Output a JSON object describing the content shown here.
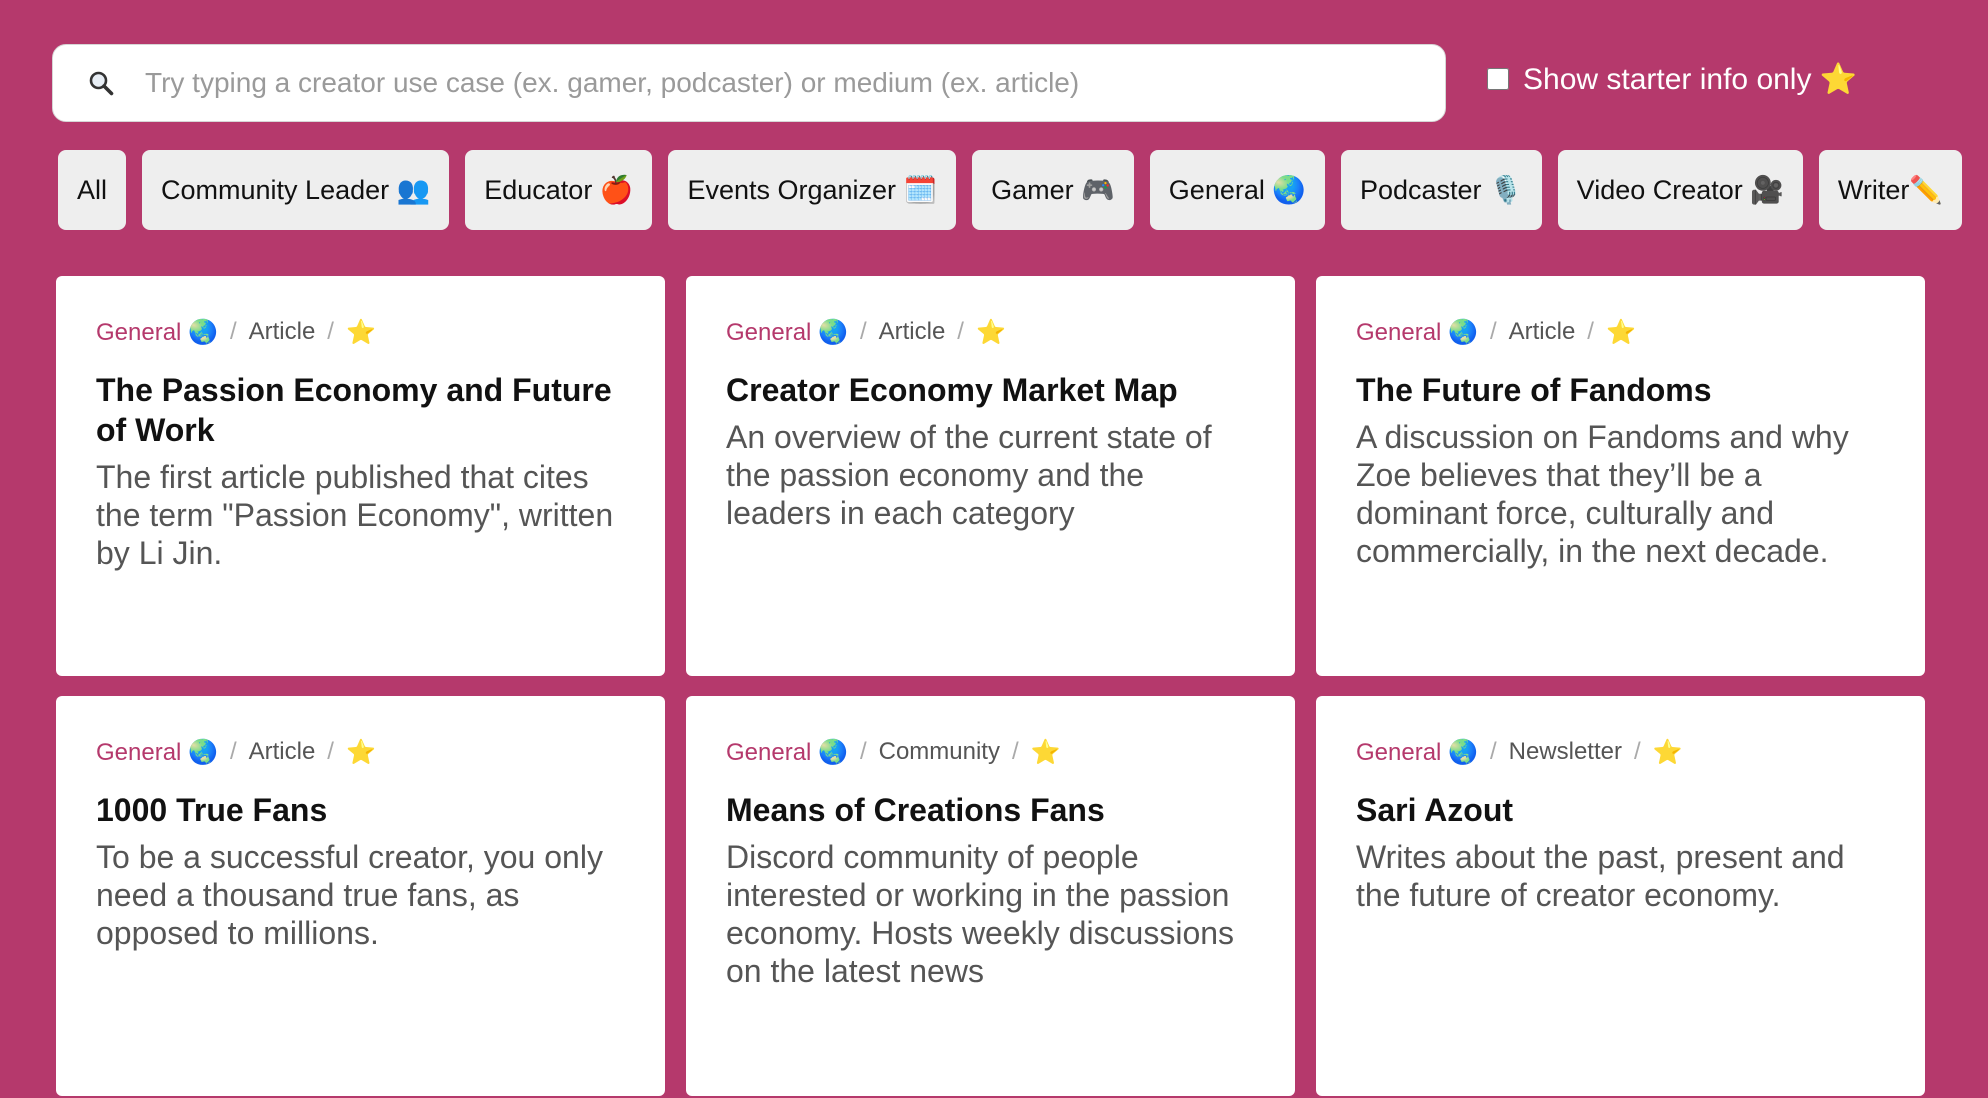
{
  "search": {
    "icon": "search-icon",
    "placeholder": "Try typing a creator use case (ex. gamer, podcaster) or medium (ex. article)"
  },
  "starter_toggle": {
    "label": "Show starter info only ⭐",
    "checked": false
  },
  "filters": [
    {
      "label": "All"
    },
    {
      "label": "Community Leader 👥"
    },
    {
      "label": "Educator 🍎"
    },
    {
      "label": "Events Organizer 🗓️"
    },
    {
      "label": "Gamer 🎮"
    },
    {
      "label": "General 🌏"
    },
    {
      "label": "Podcaster 🎙️"
    },
    {
      "label": "Video Creator 🎥"
    },
    {
      "label": "Writer✏️"
    }
  ],
  "cards": [
    {
      "category": "General 🌏",
      "medium": "Article",
      "star": "⭐",
      "title": "The Passion Economy and Future of Work",
      "description": "The first article published that cites the term \"Passion Economy\", written by Li Jin."
    },
    {
      "category": "General 🌏",
      "medium": "Article",
      "star": "⭐",
      "title": "Creator Economy Market Map",
      "description": "An overview of the current state of the passion economy and the leaders in each category"
    },
    {
      "category": "General 🌏",
      "medium": "Article",
      "star": "⭐",
      "title": "The Future of Fandoms",
      "description": "A discussion on Fandoms and why Zoe believes that they’ll be a dominant force, culturally and commercially, in the next decade."
    },
    {
      "category": "General 🌏",
      "medium": "Article",
      "star": "⭐",
      "title": "1000 True Fans",
      "description": "To be a successful creator, you only need a thousand true fans, as opposed to millions."
    },
    {
      "category": "General 🌏",
      "medium": "Community",
      "star": "⭐",
      "title": "Means of Creations Fans",
      "description": "Discord community of people interested or working in the passion economy. Hosts weekly discussions on the latest news"
    },
    {
      "category": "General 🌏",
      "medium": "Newsletter",
      "star": "⭐",
      "title": "Sari Azout",
      "description": "Writes about the past, present and the future of creator economy."
    }
  ],
  "colors": {
    "background": "#b5396c",
    "accent": "#b5396c",
    "card": "#ffffff",
    "filter": "#eeeeee"
  }
}
